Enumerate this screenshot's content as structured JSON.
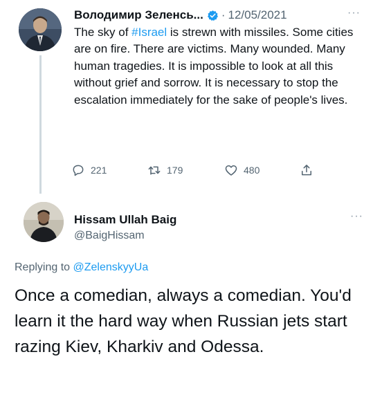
{
  "tweet1": {
    "author_name": "Володимир Зеленсь...",
    "separator": "·",
    "date": "12/05/2021",
    "more": "···",
    "text_before": "The sky of ",
    "hashtag": "#Israel",
    "text_after": " is strewn with missiles. Some cities are on fire. There are victims. Many wounded. Many human tragedies. It is impossible to look at all this without grief and sorrow. It is necessary to stop the escalation immediately for the sake of people's lives.",
    "replies": "221",
    "retweets": "179",
    "likes": "480",
    "colors": {
      "link": "#1d9bf0",
      "verified": "#1d9bf0",
      "muted": "#536471"
    }
  },
  "tweet2": {
    "author_name": "Hissam Ullah Baig",
    "handle": "@BaigHissam",
    "more": "···",
    "replying_prefix": "Replying to ",
    "replying_to": "@ZelenskyyUa",
    "text": "Once a comedian, always a comedian. You'd learn it the hard way when Russian jets start razing Kiev, Kharkiv and Odessa."
  }
}
